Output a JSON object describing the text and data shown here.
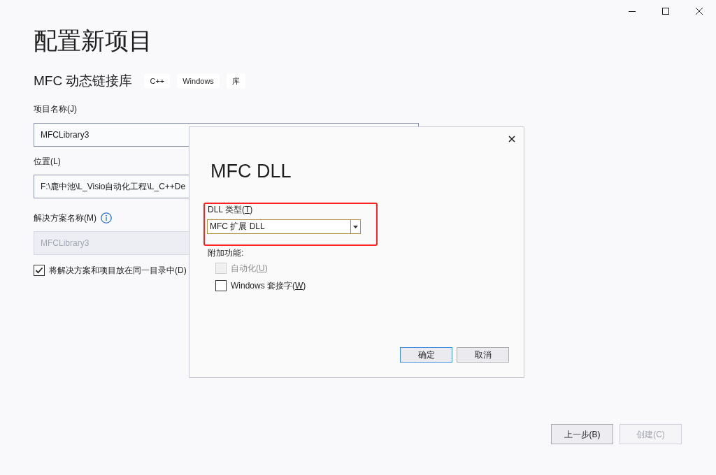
{
  "page": {
    "title": "配置新项目",
    "template": "MFC 动态链接库",
    "tags": [
      "C++",
      "Windows",
      "库"
    ]
  },
  "form": {
    "project_name": {
      "label": "项目名称(J)",
      "value": "MFCLibrary3"
    },
    "location": {
      "label": "位置(L)",
      "value": "F:\\鹿中池\\L_Visio自动化工程\\L_C++De"
    },
    "solution_name": {
      "label": "解决方案名称(M)",
      "value": "MFCLibrary3",
      "disabled": true
    },
    "same_directory": {
      "label": "将解决方案和项目放在同一目录中(D)",
      "checked": true
    }
  },
  "footer_buttons": [
    {
      "label": "上一步(B)",
      "disabled": false
    },
    {
      "label": "创建(C)",
      "disabled": true
    }
  ],
  "dialog": {
    "title": "MFC DLL",
    "dll_type": {
      "label": "DLL 类型(T)",
      "value": "MFC 扩展 DLL",
      "highlighted": true
    },
    "features_label": "附加功能:",
    "features": [
      {
        "label": "自动化(U)",
        "checked": false,
        "disabled": true
      },
      {
        "label": "Windows 套接字(W)",
        "checked": false,
        "disabled": false
      }
    ],
    "buttons": [
      {
        "label": "确定",
        "default": true
      },
      {
        "label": "取消",
        "default": false
      }
    ]
  }
}
